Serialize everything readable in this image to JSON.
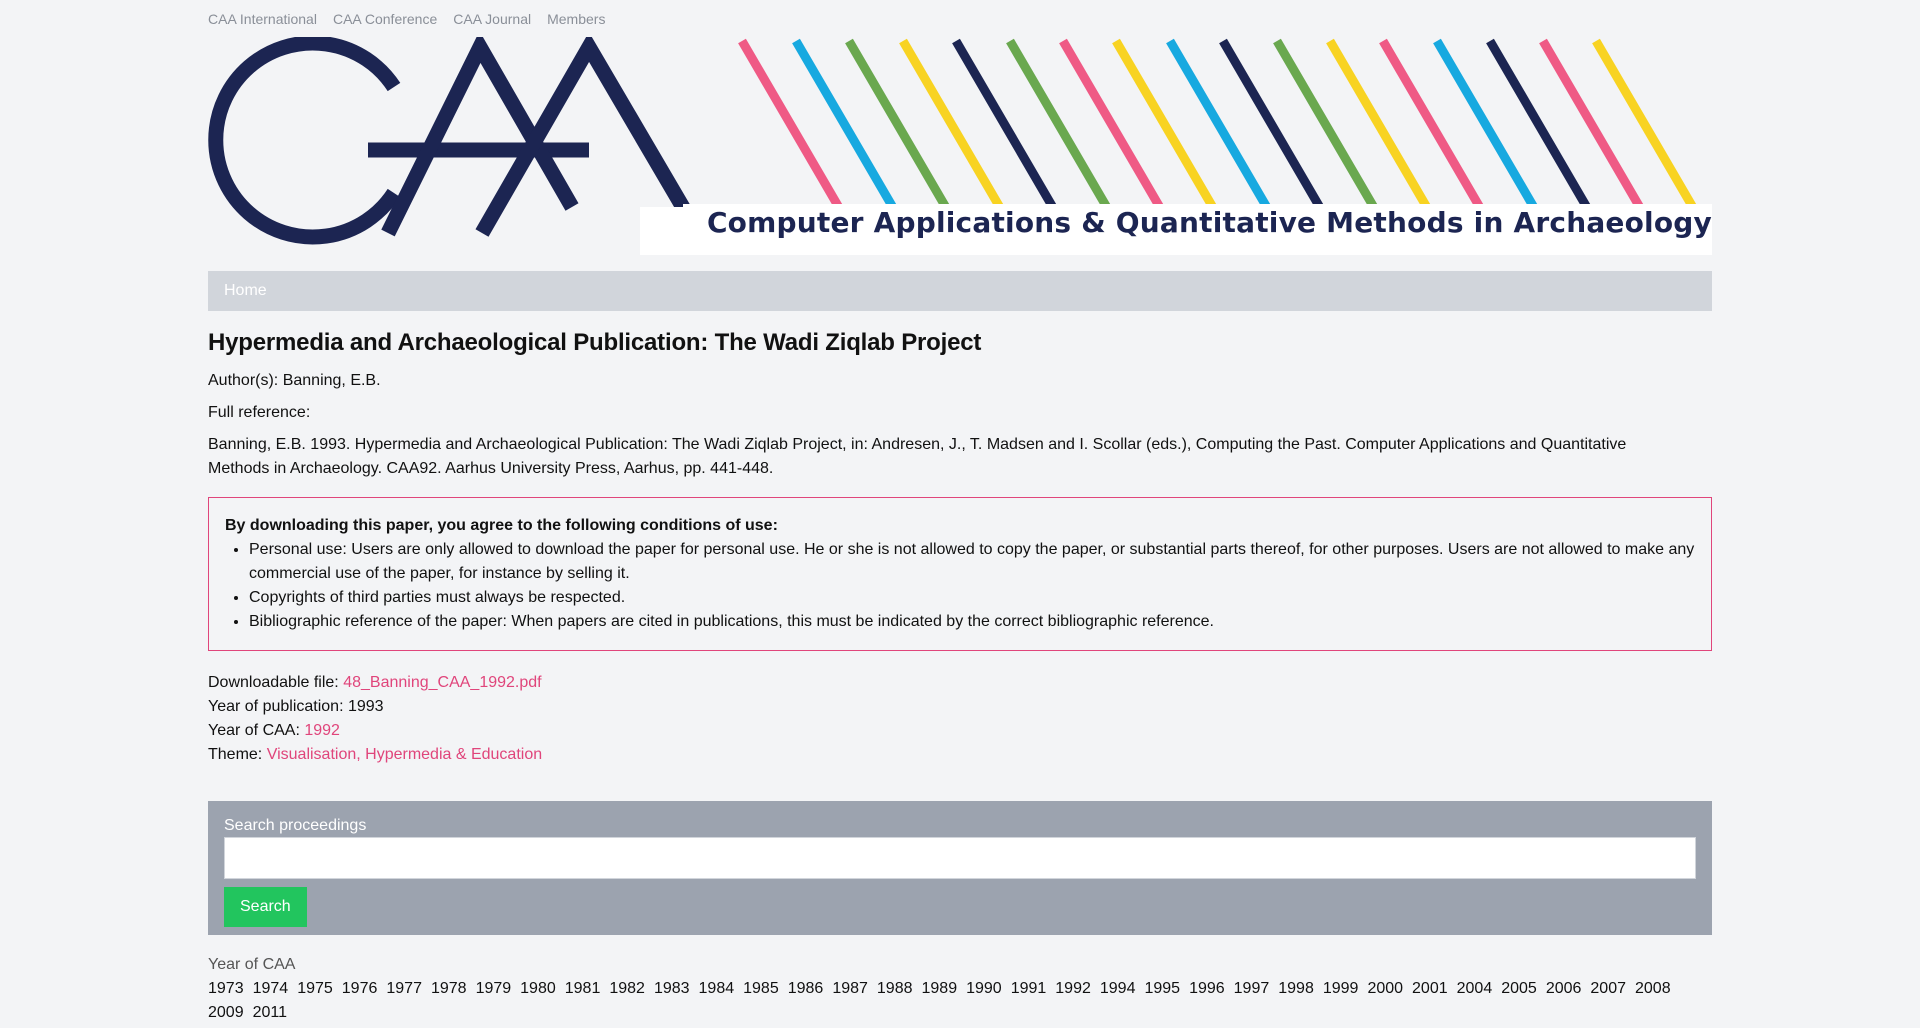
{
  "top_nav": [
    "CAA International",
    "CAA Conference",
    "CAA Journal",
    "Members"
  ],
  "banner": {
    "logo_text": "CAA",
    "tagline": "Computer Applications & Quantitative Methods in Archaeology",
    "colors": {
      "navy": "#1c2552",
      "pink": "#ef5a85",
      "blue": "#17a9e0",
      "green": "#6aa84f",
      "yellow": "#f8d322"
    }
  },
  "navbar": {
    "home_label": "Home"
  },
  "article": {
    "title": "Hypermedia and Archaeological Publication: The Wadi Ziqlab Project",
    "authors_label": "Author(s):",
    "authors": "Banning, E.B.",
    "full_reference_label": "Full reference:",
    "full_reference": "Banning, E.B. 1993. Hypermedia and Archaeological Publication: The Wadi Ziqlab Project, in: Andresen, J., T. Madsen and I. Scollar (eds.), Computing the Past. Computer Applications and Quantitative Methods in Archaeology. CAA92. Aarhus University Press, Aarhus, pp. 441-448."
  },
  "terms": {
    "heading": "By downloading this paper, you agree to the following conditions of use:",
    "items": [
      "Personal use: Users are only allowed to download the paper for personal use. He or she is not allowed to copy the paper, or substantial parts thereof, for other purposes. Users are not allowed to make any commercial use of the paper, for instance by selling it.",
      "Copyrights of third parties must always be respected.",
      "Bibliographic reference of the paper: When papers are cited in publications, this must be indicated by the correct bibliographic reference."
    ]
  },
  "meta": {
    "file_label": "Downloadable file:",
    "file_name": "48_Banning_CAA_1992.pdf",
    "pub_year_label": "Year of publication:",
    "pub_year": "1993",
    "caa_year_label": "Year of CAA:",
    "caa_year": "1992",
    "theme_label": "Theme:",
    "theme": "Visualisation, Hypermedia & Education",
    "accent_color": "#e0457b"
  },
  "search": {
    "label": "Search proceedings",
    "placeholder": "",
    "value": "",
    "button_label": "Search"
  },
  "years": {
    "label": "Year of CAA",
    "list": [
      "1973",
      "1974",
      "1975",
      "1976",
      "1977",
      "1978",
      "1979",
      "1980",
      "1981",
      "1982",
      "1983",
      "1984",
      "1985",
      "1986",
      "1987",
      "1988",
      "1989",
      "1990",
      "1991",
      "1992",
      "1994",
      "1995",
      "1996",
      "1997",
      "1998",
      "1999",
      "2000",
      "2001",
      "2004",
      "2005",
      "2006",
      "2007",
      "2008",
      "2009",
      "2011"
    ]
  }
}
